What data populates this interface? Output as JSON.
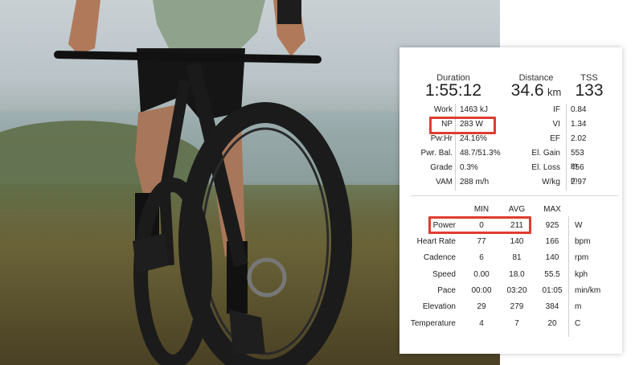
{
  "summary": [
    {
      "label": "Duration",
      "value": "1:55:12",
      "unit": ""
    },
    {
      "label": "Distance",
      "value": "34.6",
      "unit": "km"
    },
    {
      "label": "TSS",
      "value": "133",
      "unit": ""
    }
  ],
  "left_metrics": [
    {
      "label": "Work",
      "value": "1463 kJ"
    },
    {
      "label": "NP",
      "value": "283 W"
    },
    {
      "label": "Pw:Hr",
      "value": "24.16%"
    },
    {
      "label": "Pwr. Bal.",
      "value": "48.7/51.3%"
    },
    {
      "label": "Grade",
      "value": "0.3%"
    },
    {
      "label": "VAM",
      "value": "288 m/h"
    }
  ],
  "right_metrics": [
    {
      "label": "IF",
      "value": "0.84"
    },
    {
      "label": "VI",
      "value": "1.34"
    },
    {
      "label": "EF",
      "value": "2.02"
    },
    {
      "label": "El. Gain",
      "value": "553 m"
    },
    {
      "label": "El. Loss",
      "value": "456 m"
    },
    {
      "label": "W/kg",
      "value": "2.97"
    }
  ],
  "table": {
    "headers": [
      "MIN",
      "AVG",
      "MAX"
    ],
    "rows": [
      {
        "label": "Power",
        "min": "0",
        "avg": "211",
        "max": "925",
        "unit": "W"
      },
      {
        "label": "Heart Rate",
        "min": "77",
        "avg": "140",
        "max": "166",
        "unit": "bpm"
      },
      {
        "label": "Cadence",
        "min": "6",
        "avg": "81",
        "max": "140",
        "unit": "rpm"
      },
      {
        "label": "Speed",
        "min": "0.00",
        "avg": "18.0",
        "max": "55.5",
        "unit": "kph"
      },
      {
        "label": "Pace",
        "min": "00:00",
        "avg": "03:20",
        "max": "01:05",
        "unit": "min/km"
      },
      {
        "label": "Elevation",
        "min": "29",
        "avg": "279",
        "max": "384",
        "unit": "m"
      },
      {
        "label": "Temperature",
        "min": "4",
        "avg": "7",
        "max": "20",
        "unit": "C"
      }
    ]
  },
  "colors": {
    "highlight": "#e03c31"
  }
}
